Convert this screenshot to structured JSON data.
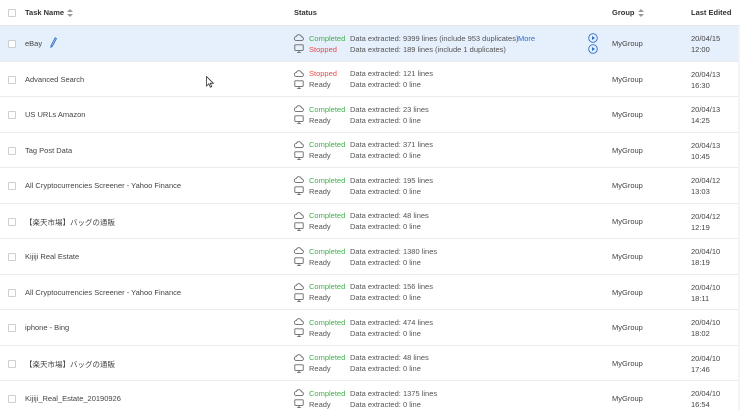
{
  "header": {
    "task_name": "Task Name",
    "status": "Status",
    "group": "Group",
    "last_edited": "Last Edited"
  },
  "more_label": "More",
  "colors": {
    "completed": "#3fae49",
    "stopped": "#e64a4a",
    "link": "#2e6fc9",
    "selected_row": "#e6effc"
  },
  "icons": {
    "cloud": "cloud-icon",
    "monitor": "monitor-icon",
    "play": "play-circle-icon",
    "edit": "pencil-icon"
  },
  "rows": [
    {
      "task": "eBay",
      "cloud_status": "Completed",
      "cloud_detail": "Data extracted: 9399 lines (include 953 duplicates)",
      "local_status": "Stopped",
      "local_detail": "Data extracted: 189 lines (include 1 duplicates)",
      "group": "MyGroup",
      "date": "20/04/15",
      "time": "12:00"
    },
    {
      "task": "Advanced Search",
      "cloud_status": "Stopped",
      "cloud_detail": "Data extracted: 121 lines",
      "local_status": "Ready",
      "local_detail": "Data extracted: 0 line",
      "group": "MyGroup",
      "date": "20/04/13",
      "time": "16:30"
    },
    {
      "task": "US URLs Amazon",
      "cloud_status": "Completed",
      "cloud_detail": "Data extracted: 23 lines",
      "local_status": "Ready",
      "local_detail": "Data extracted: 0 line",
      "group": "MyGroup",
      "date": "20/04/13",
      "time": "14:25"
    },
    {
      "task": "Tag Post Data",
      "cloud_status": "Completed",
      "cloud_detail": "Data extracted: 371 lines",
      "local_status": "Ready",
      "local_detail": "Data extracted: 0 line",
      "group": "MyGroup",
      "date": "20/04/13",
      "time": "10:45"
    },
    {
      "task": "All Cryptocurrencies Screener - Yahoo Finance",
      "cloud_status": "Completed",
      "cloud_detail": "Data extracted: 195 lines",
      "local_status": "Ready",
      "local_detail": "Data extracted: 0 line",
      "group": "MyGroup",
      "date": "20/04/12",
      "time": "13:03"
    },
    {
      "task": "【楽天市場】バッグの通販",
      "cloud_status": "Completed",
      "cloud_detail": "Data extracted: 48 lines",
      "local_status": "Ready",
      "local_detail": "Data extracted: 0 line",
      "group": "MyGroup",
      "date": "20/04/12",
      "time": "12:19"
    },
    {
      "task": "Kijiji Real Estate",
      "cloud_status": "Completed",
      "cloud_detail": "Data extracted: 1380 lines",
      "local_status": "Ready",
      "local_detail": "Data extracted: 0 line",
      "group": "MyGroup",
      "date": "20/04/10",
      "time": "18:19"
    },
    {
      "task": "All Cryptocurrencies Screener - Yahoo Finance",
      "cloud_status": "Completed",
      "cloud_detail": "Data extracted: 156 lines",
      "local_status": "Ready",
      "local_detail": "Data extracted: 0 line",
      "group": "MyGroup",
      "date": "20/04/10",
      "time": "18:11"
    },
    {
      "task": "iphone - Bing",
      "cloud_status": "Completed",
      "cloud_detail": "Data extracted: 474 lines",
      "local_status": "Ready",
      "local_detail": "Data extracted: 0 line",
      "group": "MyGroup",
      "date": "20/04/10",
      "time": "18:02"
    },
    {
      "task": "【楽天市場】バッグの通販",
      "cloud_status": "Completed",
      "cloud_detail": "Data extracted: 48 lines",
      "local_status": "Ready",
      "local_detail": "Data extracted: 0 line",
      "group": "MyGroup",
      "date": "20/04/10",
      "time": "17:46"
    },
    {
      "task": "Kijiji_Real_Estate_20190926",
      "cloud_status": "Completed",
      "cloud_detail": "Data extracted: 1375 lines",
      "local_status": "Ready",
      "local_detail": "Data extracted: 0 line",
      "group": "MyGroup",
      "date": "20/04/10",
      "time": "16:54"
    }
  ]
}
